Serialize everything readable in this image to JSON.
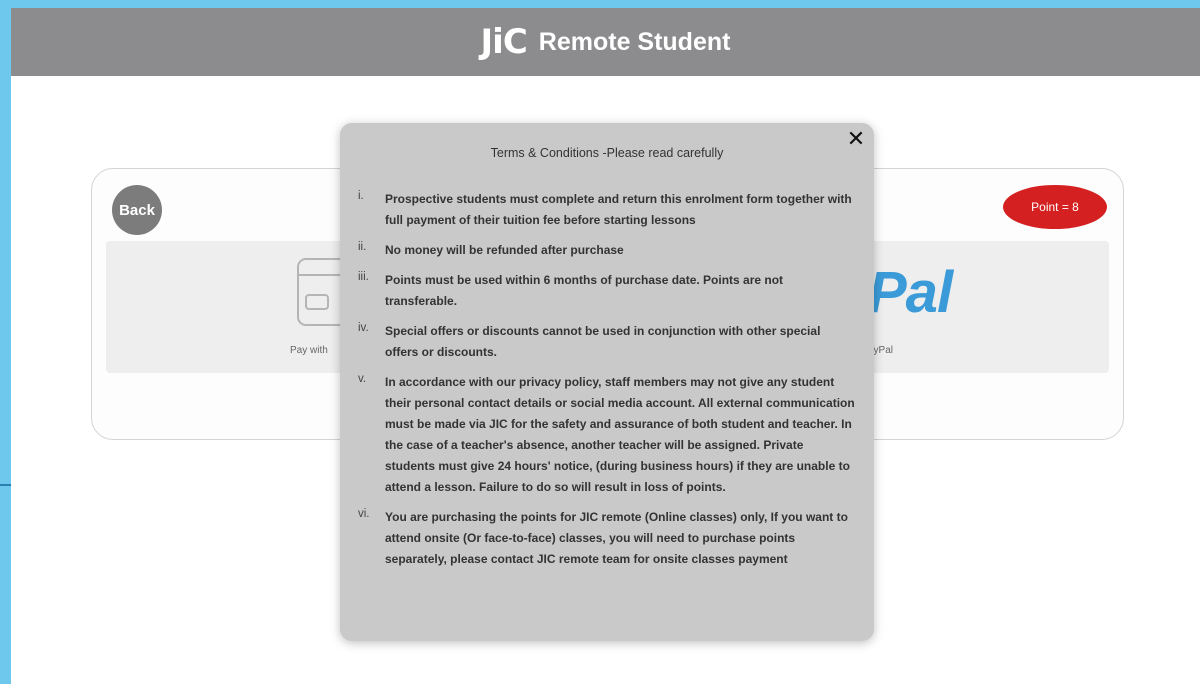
{
  "header": {
    "logo_text": "JiC",
    "app_title": "Remote Student"
  },
  "page": {
    "back_label": "Back",
    "point_badge": "Point = 8",
    "pay_card_label": "Pay with",
    "paypal_logo": "Pal",
    "paypal_label": "ayPal"
  },
  "modal": {
    "title": "Terms & Conditions -Please read carefully",
    "close_glyph": "✕",
    "terms": [
      {
        "num": "i.",
        "text": "Prospective students must complete and return this enrolment form together with full payment of their tuition fee before starting lessons"
      },
      {
        "num": "ii.",
        "text": "No money will be refunded after purchase"
      },
      {
        "num": "iii.",
        "text": "Points must be used within 6 months of purchase date. Points are not transferable."
      },
      {
        "num": "iv.",
        "text": "Special offers or discounts cannot be used in conjunction with other special offers or discounts."
      },
      {
        "num": "v.",
        "text": "In accordance with our privacy policy, staff members may not give any student their personal contact details or social media account. All external communication must be made via JIC for the safety and assurance of both student and teacher. In the case of a teacher's absence, another teacher will be assigned. Private students must give 24 hours' notice, (during business hours) if they are unable to attend a lesson. Failure to do so will result in loss of points."
      },
      {
        "num": "vi.",
        "text": "You are purchasing the points for JIC remote (Online classes) only, If you want to attend onsite (Or face-to-face) classes, you will need to purchase points separately, please contact JIC remote team for onsite classes payment"
      }
    ]
  },
  "colors": {
    "header_bg": "#8c8c8e",
    "badge_red": "#d42020",
    "logo_dot_red": "#e8322b",
    "paypal_blue": "#3b9bd8",
    "outer_frame": "#6ec8ee"
  },
  "icons": {
    "card": "credit-card-icon",
    "close": "close-icon"
  }
}
